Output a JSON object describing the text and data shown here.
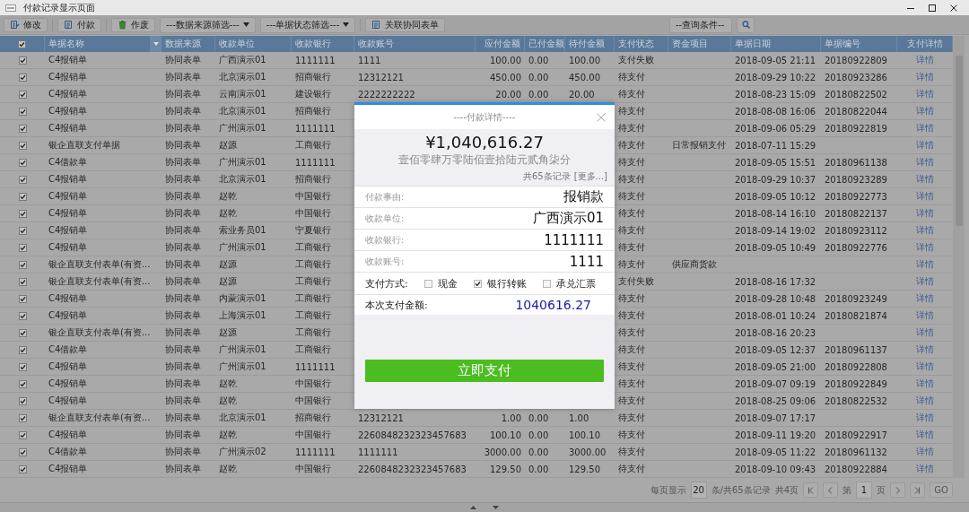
{
  "window": {
    "title": "付款记录显示页面"
  },
  "toolbar": {
    "items": [
      {
        "kind": "edit",
        "label": "修改"
      },
      {
        "kind": "doc",
        "label": "付款"
      },
      {
        "kind": "trash",
        "label": "作废"
      },
      {
        "kind": "select",
        "label": "---数据来源筛选---"
      },
      {
        "kind": "select",
        "label": "---单据状态筛选---"
      },
      {
        "kind": "doc",
        "label": "关联协同表单"
      }
    ],
    "query": {
      "label": "--查询条件--"
    }
  },
  "table": {
    "header_checked": true,
    "columns": [
      "单据名称",
      "数据来源",
      "收款单位",
      "收款银行",
      "收款账号",
      "应付金额",
      "已付金额",
      "待付金额",
      "支付状态",
      "资金项目",
      "单据日期",
      "单据编号",
      "支付详情"
    ],
    "rows": [
      {
        "checked": true,
        "name": "C4报销单",
        "source": "协同表单",
        "payee": "广西演示01",
        "bank": "1111111",
        "account": "1111",
        "payable": "100.00",
        "paid": "0.00",
        "pending": "100.00",
        "status": "支付失败",
        "date": "2018-09-05 21:11",
        "number": "20180922809",
        "detail": "详情"
      },
      {
        "checked": true,
        "name": "C4报销单",
        "source": "协同表单",
        "payee": "北京演示01",
        "bank": "招商银行",
        "account": "12312121",
        "payable": "450.00",
        "paid": "0.00",
        "pending": "450.00",
        "status": "待支付",
        "date": "2018-09-29 10:22",
        "number": "20180923286",
        "detail": "详情"
      },
      {
        "checked": true,
        "name": "C4报销单",
        "source": "协同表单",
        "payee": "云南演示01",
        "bank": "建设银行",
        "account": "2222222222",
        "payable": "20.00",
        "paid": "0.00",
        "pending": "20.00",
        "status": "待支付",
        "date": "2018-08-23 15:09",
        "number": "20180822502",
        "detail": "详情"
      },
      {
        "checked": true,
        "name": "C4报销单",
        "source": "协同表单",
        "payee": "北京演示01",
        "bank": "招商银行",
        "status": "待支付",
        "date": "2018-08-08 16:06",
        "number": "20180822044",
        "detail": "详情"
      },
      {
        "checked": true,
        "name": "C4报销单",
        "source": "协同表单",
        "payee": "广州演示01",
        "bank": "1111111",
        "status": "待支付",
        "date": "2018-09-06 05:29",
        "number": "20180922819",
        "detail": "详情"
      },
      {
        "checked": true,
        "name": "银企直联支付单据",
        "source": "协同表单",
        "payee": "赵源",
        "bank": "工商银行",
        "status": "待支付",
        "fund_item": "日常报销支付",
        "date": "2018-07-11 15:29",
        "detail": "详情"
      },
      {
        "checked": true,
        "name": "C4借款单",
        "source": "协同表单",
        "payee": "广州演示01",
        "bank": "1111111",
        "status": "待支付",
        "date": "2018-09-05 15:51",
        "number": "20180961138",
        "detail": "详情"
      },
      {
        "checked": true,
        "name": "C4报销单",
        "source": "协同表单",
        "payee": "北京演示01",
        "bank": "招商银行",
        "status": "待支付",
        "date": "2018-09-29 10:37",
        "number": "20180923289",
        "detail": "详情"
      },
      {
        "checked": true,
        "name": "C4报销单",
        "source": "协同表单",
        "payee": "赵乾",
        "bank": "中国银行",
        "status": "待支付",
        "date": "2018-09-05 10:12",
        "number": "20180922773",
        "detail": "详情"
      },
      {
        "checked": true,
        "name": "C4报销单",
        "source": "协同表单",
        "payee": "赵乾",
        "bank": "中国银行",
        "status": "待支付",
        "date": "2018-08-14 16:10",
        "number": "20180822137",
        "detail": "详情"
      },
      {
        "checked": true,
        "name": "C4报销单",
        "source": "协同表单",
        "payee": "索业务员01",
        "bank": "宁夏银行",
        "status": "待支付",
        "date": "2018-09-14 19:02",
        "number": "20180923112",
        "detail": "详情"
      },
      {
        "checked": true,
        "name": "C4报销单",
        "source": "协同表单",
        "payee": "广州演示01",
        "bank": "工商银行",
        "status": "待支付",
        "date": "2018-09-05 10:49",
        "number": "20180922776",
        "detail": "详情"
      },
      {
        "checked": true,
        "name": "银企直联支付表单(有资...",
        "source": "协同表单",
        "payee": "赵源",
        "bank": "工商银行",
        "status": "待支付",
        "fund_item": "供应商货款",
        "detail": "详情"
      },
      {
        "checked": true,
        "name": "银企直联支付表单(有资...",
        "source": "协同表单",
        "payee": "赵源",
        "bank": "工商银行",
        "status": "支付失败",
        "date": "2018-08-16 17:32",
        "detail": "详情"
      },
      {
        "checked": true,
        "name": "C4报销单",
        "source": "协同表单",
        "payee": "内蒙演示01",
        "bank": "工商银行",
        "status": "待支付",
        "date": "2018-09-28 10:48",
        "number": "20180923249",
        "detail": "详情"
      },
      {
        "checked": true,
        "name": "C4报销单",
        "source": "协同表单",
        "payee": "上海演示01",
        "bank": "工商银行",
        "status": "待支付",
        "date": "2018-08-01 10:24",
        "number": "20180821874",
        "detail": "详情"
      },
      {
        "checked": true,
        "name": "银企直联支付表单(有资...",
        "source": "协同表单",
        "payee": "赵源",
        "bank": "工商银行",
        "status": "待支付",
        "date": "2018-08-16 20:23",
        "detail": "详情"
      },
      {
        "checked": true,
        "name": "C4借款单",
        "source": "协同表单",
        "payee": "广州演示01",
        "bank": "工商银行",
        "status": "待支付",
        "date": "2018-09-05 12:37",
        "number": "20180961137",
        "detail": "详情"
      },
      {
        "checked": true,
        "name": "C4报销单",
        "source": "协同表单",
        "payee": "广州演示01",
        "bank": "1111111",
        "status": "待支付",
        "date": "2018-09-05 21:00",
        "number": "20180922808",
        "detail": "详情"
      },
      {
        "checked": true,
        "name": "C4报销单",
        "source": "协同表单",
        "payee": "赵乾",
        "bank": "中国银行",
        "status": "待支付",
        "date": "2018-09-07 09:19",
        "number": "20180922849",
        "detail": "详情"
      },
      {
        "checked": true,
        "name": "C4报销单",
        "source": "协同表单",
        "payee": "赵乾",
        "bank": "中国银行",
        "status": "待支付",
        "date": "2018-08-25 09:06",
        "number": "20180822532",
        "detail": "详情"
      },
      {
        "checked": true,
        "name": "银企直联支付表单(有资...",
        "source": "协同表单",
        "payee": "北京演示01",
        "bank": "招商银行",
        "account": "12312121",
        "payable": "1.00",
        "paid": "0.00",
        "pending": "1.00",
        "status": "待支付",
        "date": "2018-09-07 17:17",
        "detail": "详情"
      },
      {
        "checked": true,
        "name": "C4报销单",
        "source": "协同表单",
        "payee": "赵乾",
        "bank": "中国银行",
        "account": "2260848232323457683",
        "payable": "100.10",
        "paid": "0.00",
        "pending": "100.10",
        "status": "待支付",
        "date": "2018-09-11 19:20",
        "number": "20180922917",
        "detail": "详情"
      },
      {
        "checked": true,
        "name": "C4借款单",
        "source": "协同表单",
        "payee": "广州演示02",
        "bank": "1111111",
        "account": "1111111",
        "payable": "3000.00",
        "paid": "0.00",
        "pending": "3000.00",
        "status": "待支付",
        "date": "2018-09-05 11:22",
        "number": "20180961132",
        "detail": "详情"
      },
      {
        "checked": true,
        "name": "C4报销单",
        "source": "协同表单",
        "payee": "赵乾",
        "bank": "中国银行",
        "account": "2260848232323457683",
        "payable": "129.50",
        "paid": "0.00",
        "pending": "129.50",
        "status": "待支付",
        "date": "2018-09-10 09:43",
        "number": "20180922884",
        "detail": "详情"
      }
    ]
  },
  "pager": {
    "per_page_label": "每页显示",
    "per_page": "20",
    "total_label": "条/共65条记录",
    "pages_label": "共4页",
    "page_prefix": "第",
    "page": "1",
    "page_suffix": "页",
    "go": "GO"
  },
  "dialog": {
    "title": "----付款详情----",
    "amount": "¥1,040,616.27",
    "amount_words": "壹佰零肆万零陆佰壹拾陆元贰角柒分",
    "records": "共65条记录",
    "more": "[更多...]",
    "fields": [
      {
        "label": "付款事由:",
        "value": "报销款"
      },
      {
        "label": "收款单位:",
        "value": "广西演示01"
      },
      {
        "label": "收款银行:",
        "value": "1111111"
      },
      {
        "label": "收款账号:",
        "value": "1111"
      }
    ],
    "pay_method_label": "支付方式:",
    "pay_methods": [
      {
        "label": "现金",
        "checked": false
      },
      {
        "label": "银行转账",
        "checked": true
      },
      {
        "label": "承兑汇票",
        "checked": false
      }
    ],
    "pay_amount_label": "本次支付金额:",
    "pay_amount": "1040616.27",
    "submit": "立即支付"
  }
}
